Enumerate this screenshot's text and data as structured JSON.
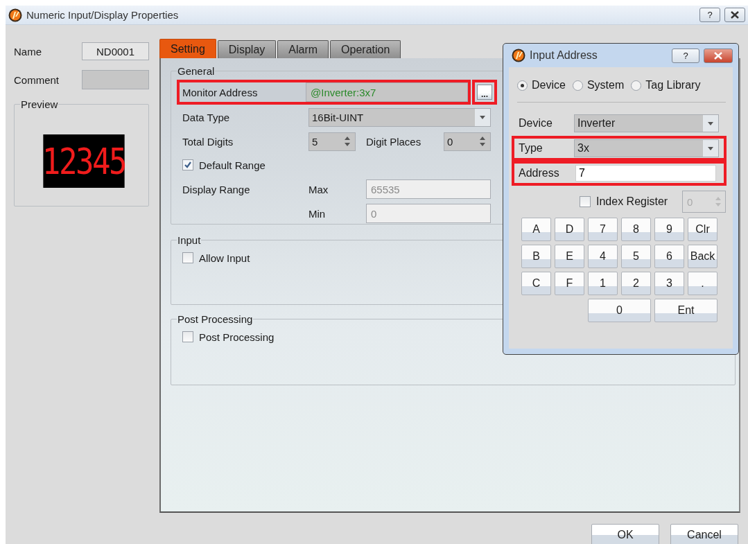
{
  "window": {
    "title": "Numeric Input/Display Properties",
    "help": "?"
  },
  "name": {
    "label": "Name",
    "value": "ND0001"
  },
  "comment": {
    "label": "Comment"
  },
  "preview": {
    "title": "Preview",
    "display": "12345"
  },
  "tabs": [
    {
      "label": "Setting",
      "selected": true
    },
    {
      "label": "Display",
      "selected": false
    },
    {
      "label": "Alarm",
      "selected": false
    },
    {
      "label": "Operation",
      "selected": false
    }
  ],
  "general": {
    "title": "General",
    "monitor_address": {
      "label": "Monitor Address",
      "value": "@Inverter:3x7",
      "button": "...",
      "highlighted": true
    },
    "data_type": {
      "label": "Data Type",
      "value": "16Bit-UINT"
    },
    "total_digits": {
      "label": "Total Digits",
      "value": "5"
    },
    "digit_places": {
      "label": "Digit Places",
      "value": "0"
    },
    "default_range": {
      "label": "Default Range",
      "checked": true
    },
    "display_range": {
      "label": "Display Range",
      "max_label": "Max",
      "max": "65535",
      "min_label": "Min",
      "min": "0",
      "disabled": true
    }
  },
  "input": {
    "title": "Input",
    "allow_input": {
      "label": "Allow Input",
      "checked": false
    }
  },
  "post_processing": {
    "title": "Post Processing",
    "option": {
      "label": "Post Processing",
      "checked": false
    }
  },
  "buttons": [
    "OK",
    "Cancel"
  ],
  "dialog": {
    "title": "Input Address",
    "help": "?",
    "sources": [
      {
        "label": "Device",
        "selected": true
      },
      {
        "label": "System",
        "selected": false
      },
      {
        "label": "Tag Library",
        "selected": false
      }
    ],
    "device": {
      "label": "Device",
      "value": "Inverter",
      "highlighted": false
    },
    "type": {
      "label": "Type",
      "value": "3x",
      "highlighted": true
    },
    "address": {
      "label": "Address",
      "value": "7",
      "highlighted": true
    },
    "index_register": {
      "label": "Index Register",
      "checked": false,
      "value": "0"
    },
    "keys": [
      {
        "label": "A",
        "kind": "key"
      },
      {
        "label": "D",
        "kind": "key"
      },
      {
        "label": "7",
        "kind": "key"
      },
      {
        "label": "8",
        "kind": "key"
      },
      {
        "label": "9",
        "kind": "key"
      },
      {
        "label": "Clr",
        "kind": "key"
      },
      {
        "label": "B",
        "kind": "key"
      },
      {
        "label": "E",
        "kind": "key"
      },
      {
        "label": "4",
        "kind": "key"
      },
      {
        "label": "5",
        "kind": "key"
      },
      {
        "label": "6",
        "kind": "key"
      },
      {
        "label": "Back",
        "kind": "key"
      },
      {
        "label": "C",
        "kind": "key"
      },
      {
        "label": "F",
        "kind": "key"
      },
      {
        "label": "1",
        "kind": "key"
      },
      {
        "label": "2",
        "kind": "key"
      },
      {
        "label": "3",
        "kind": "key"
      },
      {
        "label": ".",
        "kind": "key"
      },
      {
        "label": "0",
        "kind": "wide"
      },
      {
        "label": "Ent",
        "kind": "wide"
      }
    ]
  }
}
